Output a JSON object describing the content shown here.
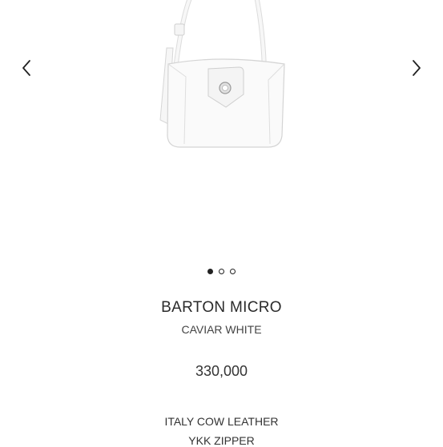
{
  "carousel": {
    "prev_icon": "chevron-left-icon",
    "next_icon": "chevron-right-icon",
    "slide_count": 3,
    "active_slide": 1
  },
  "product": {
    "name": "BARTON MICRO",
    "color": "CAVIAR WHITE",
    "price": "330,000",
    "specs": [
      "ITALY COW LEATHER",
      "YKK ZIPPER"
    ]
  },
  "colors": {
    "text": "#222222",
    "background": "#ffffff"
  }
}
